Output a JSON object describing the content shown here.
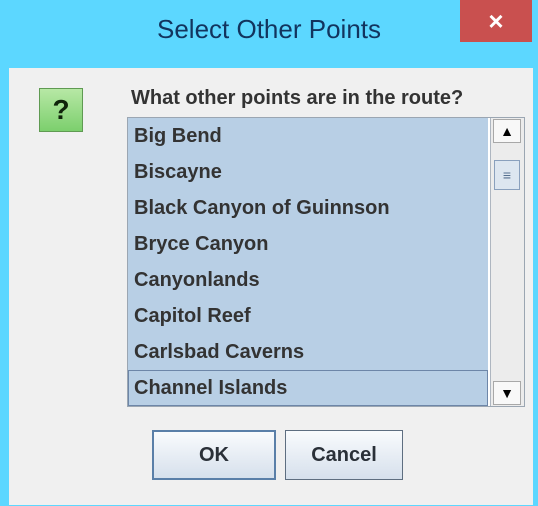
{
  "window": {
    "title": "Select Other Points",
    "close_glyph": "×"
  },
  "dialog": {
    "icon_glyph": "?",
    "prompt": "What other points are in the route?",
    "items": [
      "Big Bend",
      "Biscayne",
      "Black Canyon of Guinnson",
      "Bryce Canyon",
      "Canyonlands",
      "Capitol Reef",
      "Carlsbad Caverns",
      "Channel Islands"
    ],
    "selected_item": "Channel Islands",
    "ok_label": "OK",
    "cancel_label": "Cancel"
  },
  "icons": {
    "question": "question-icon",
    "scroll_up": "▲",
    "scroll_down": "▼",
    "thumb_grip": "≡"
  },
  "colors": {
    "titlebar": "#5cd7ff",
    "close": "#c9504f",
    "list_selection": "#b8cfe5",
    "icon_green": "#7ccf6d"
  }
}
